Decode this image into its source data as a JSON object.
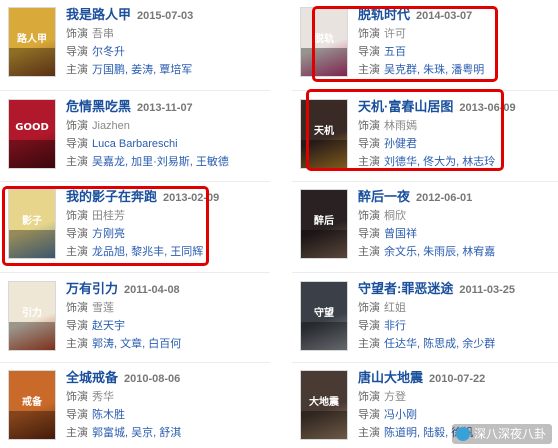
{
  "labels": {
    "director": "饰演",
    "writer": "导演",
    "cast": "主演"
  },
  "movies": [
    {
      "title": "我是路人甲",
      "date": "2015-07-03",
      "role": "吾串",
      "director": "尔冬升",
      "cast": [
        "万国鹏",
        "姜涛",
        "覃培军"
      ],
      "poster_bg": "#d9a93a",
      "poster_accent": "#8a4b1f",
      "poster_text": "路人甲"
    },
    {
      "title": "脱轨时代",
      "date": "2014-03-07",
      "role": "许可",
      "director": "五百",
      "cast": [
        "吴克群",
        "朱珠",
        "潘粤明"
      ],
      "poster_bg": "#e8e3de",
      "poster_accent": "#c0397a",
      "poster_text": "脱轨"
    },
    {
      "title": "危情黑吃黑",
      "date": "2013-11-07",
      "role": "Jiazhen",
      "director": "Luca Barbareschi",
      "cast": [
        "吴嘉龙",
        "加里·刘易斯",
        "王敏德"
      ],
      "poster_bg": "#b2182b",
      "poster_accent": "#5a0d12",
      "poster_text": "GOOD"
    },
    {
      "title": "天机·富春山居图",
      "date": "2013-06-09",
      "role": "林雨嫣",
      "director": "孙健君",
      "cast": [
        "刘德华",
        "佟大为",
        "林志玲"
      ],
      "poster_bg": "#3a2a25",
      "poster_accent": "#c28a2c",
      "poster_text": "天机"
    },
    {
      "title": "我的影子在奔跑",
      "date": "2013-02-09",
      "role": "田桂芳",
      "director": "方刚亮",
      "cast": [
        "龙品旭",
        "黎兆丰",
        "王同辉"
      ],
      "poster_bg": "#e6d58a",
      "poster_accent": "#5c86a8",
      "poster_text": "影子"
    },
    {
      "title": "醉后一夜",
      "date": "2012-06-01",
      "role": "桐欣",
      "director": "曾国祥",
      "cast": [
        "余文乐",
        "朱雨辰",
        "林宥嘉"
      ],
      "poster_bg": "#2a2222",
      "poster_accent": "#8a6c5a",
      "poster_text": "醉后"
    },
    {
      "title": "万有引力",
      "date": "2011-04-08",
      "role": "雪莲",
      "director": "赵天宇",
      "cast": [
        "郭涛",
        "文章",
        "白百何"
      ],
      "poster_bg": "#efe7d6",
      "poster_accent": "#c24a2a",
      "poster_text": "引力"
    },
    {
      "title": "守望者:罪恶迷途",
      "date": "2011-03-25",
      "role": "红姐",
      "director": "非行",
      "cast": [
        "任达华",
        "陈思成",
        "余少群"
      ],
      "poster_bg": "#3b4048",
      "poster_accent": "#9aa0a8",
      "poster_text": "守望"
    },
    {
      "title": "全城戒备",
      "date": "2010-08-06",
      "role": "秀华",
      "director": "陈木胜",
      "cast": [
        "郭富城",
        "吴京",
        "舒淇"
      ],
      "poster_bg": "#c96a2a",
      "poster_accent": "#6a2a12",
      "poster_text": "戒备"
    },
    {
      "title": "唐山大地震",
      "date": "2010-07-22",
      "role": "方登",
      "director": "冯小刚",
      "cast": [
        "陈道明",
        "陆毅",
        "徐帆"
      ],
      "poster_bg": "#4a3a34",
      "poster_accent": "#a88a6a",
      "poster_text": "大地震"
    }
  ],
  "watermark": "深八深夜八卦"
}
